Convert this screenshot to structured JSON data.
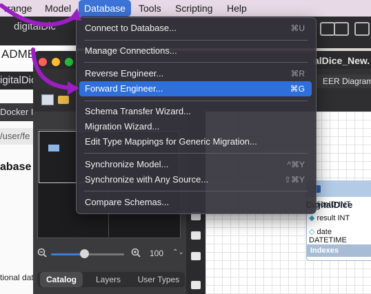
{
  "menubar": {
    "items": [
      {
        "label": "rrange"
      },
      {
        "label": "Model"
      },
      {
        "label": "Database"
      },
      {
        "label": "Tools"
      },
      {
        "label": "Scripting"
      },
      {
        "label": "Help"
      }
    ],
    "active_index": 2
  },
  "background": {
    "tab1": "digitalDic",
    "tab2": "ADME.m",
    "tab3": "igitalDic",
    "left_bar": "Docker I",
    "path": "/user/fe",
    "heading": "abase (",
    "body_text": "tional data"
  },
  "workbench": {
    "title_right": "alDice_New.",
    "tab_right": "EER Diagram",
    "zoom_value": "100",
    "zoom_level": 0.45,
    "bottom_tabs": [
      "Catalog",
      "Layers",
      "User Types"
    ],
    "bottom_tab_selected": 0
  },
  "table": {
    "name": "DigitalDice",
    "columns": [
      "diceID INT",
      "result INT",
      "date DATETIME"
    ],
    "indexes_label": "Indexes"
  },
  "menu": {
    "items": [
      {
        "label": "Connect to Database...",
        "shortcut": "⌘U"
      },
      {
        "label": "Manage Connections...",
        "shortcut": ""
      },
      {
        "label": "Reverse Engineer...",
        "shortcut": "⌘R"
      },
      {
        "label": "Forward Engineer...",
        "shortcut": "⌘G"
      },
      {
        "label": "Schema Transfer Wizard...",
        "shortcut": ""
      },
      {
        "label": "Migration Wizard...",
        "shortcut": ""
      },
      {
        "label": "Edit Type Mappings for Generic Migration...",
        "shortcut": ""
      },
      {
        "label": "Synchronize Model...",
        "shortcut": "^⌘Y"
      },
      {
        "label": "Synchronize with Any Source...",
        "shortcut": "⇧⌘Y"
      },
      {
        "label": "Compare Schemas...",
        "shortcut": ""
      }
    ],
    "highlighted_index": 3
  },
  "colors": {
    "menu_highlight": "#2f6fdb",
    "annotation_arrow": "#9b1fc4",
    "menubar_active": "#3d73d6"
  }
}
